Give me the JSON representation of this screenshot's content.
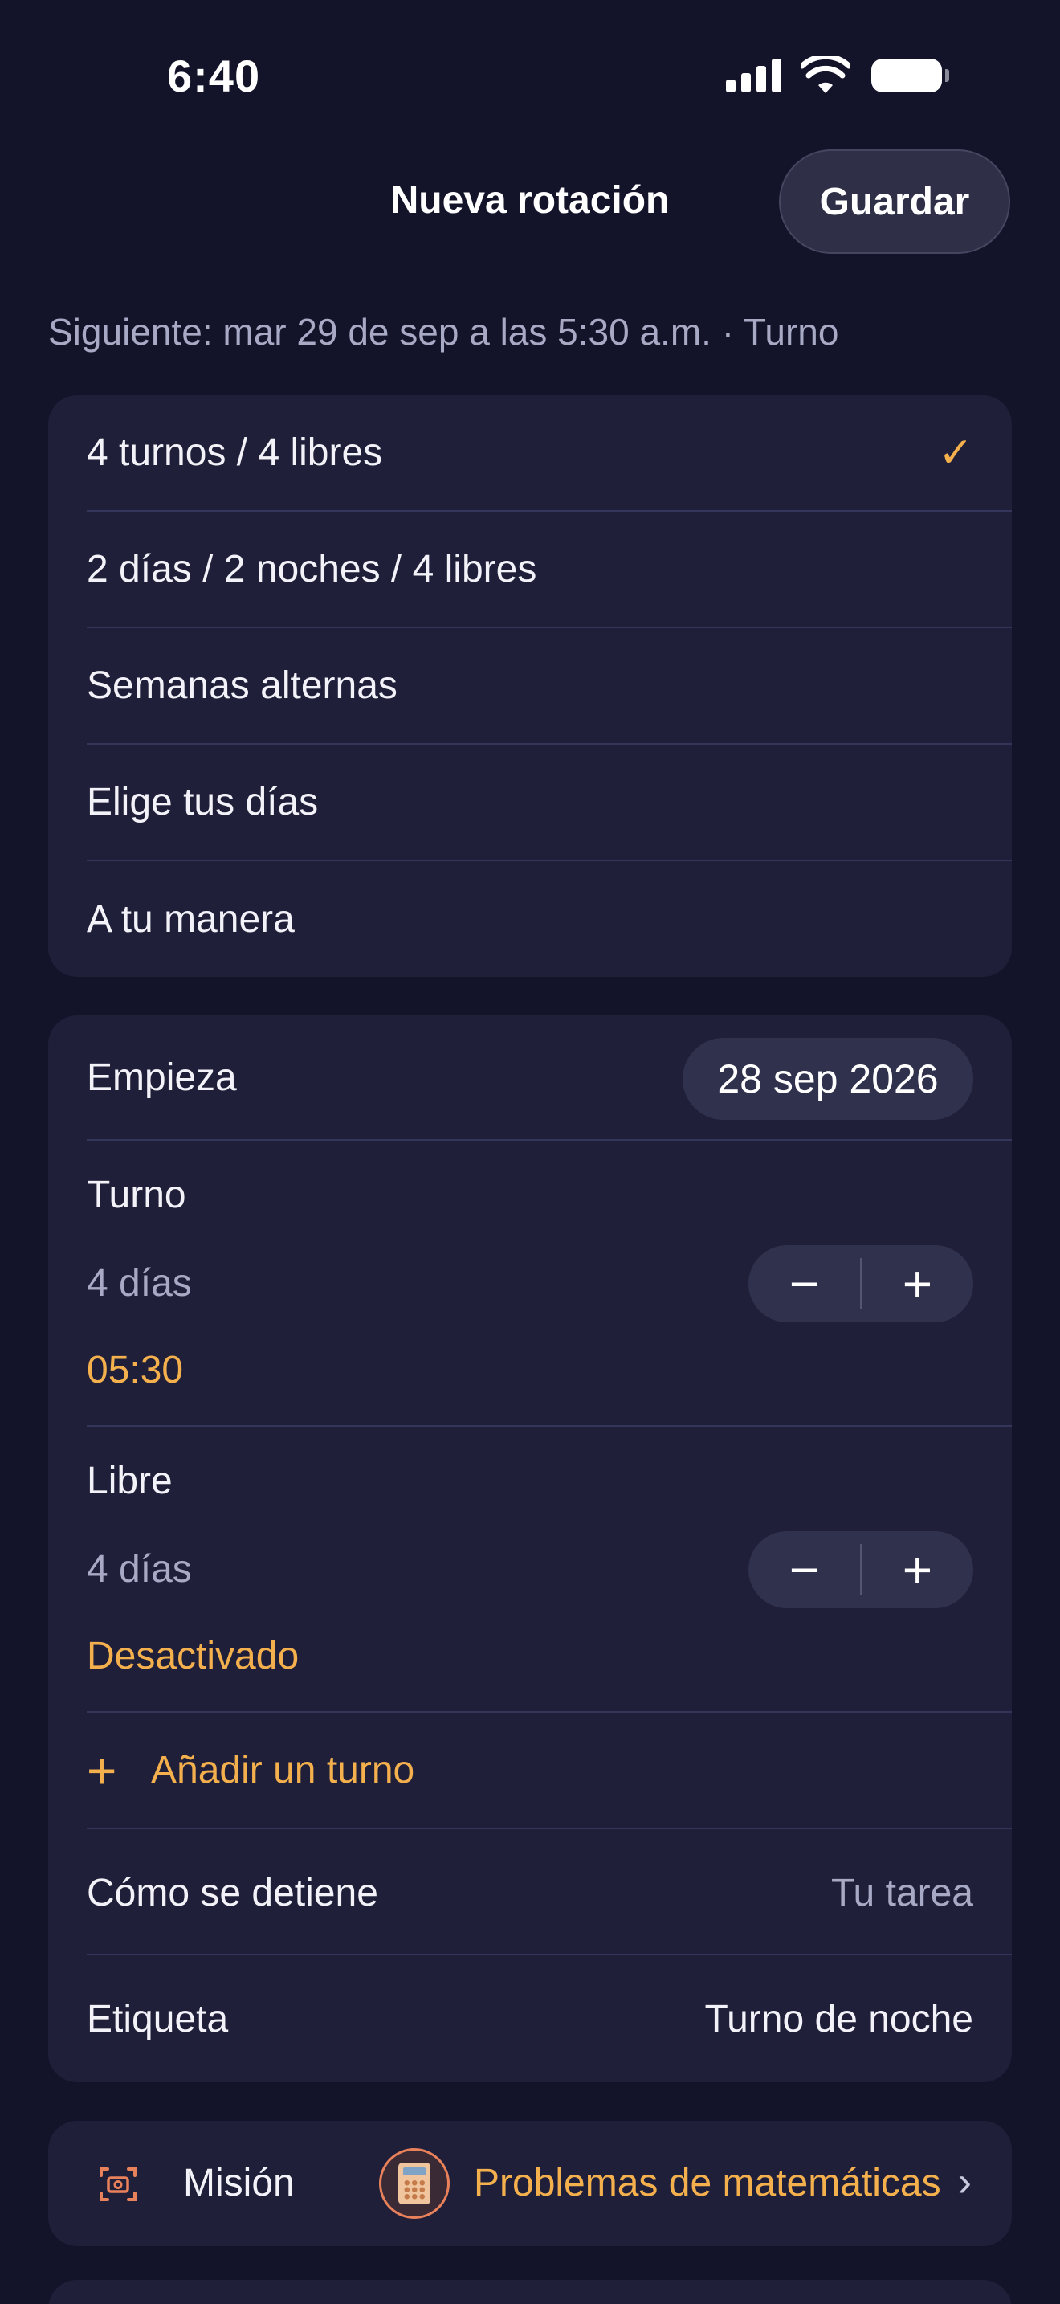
{
  "status_bar": {
    "time": "6:40"
  },
  "nav": {
    "title": "Nueva rotación",
    "save_label": "Guardar"
  },
  "next_alarm": "Siguiente: mar 29 de sep a las 5:30 a.m. · Turno",
  "patterns": [
    {
      "label": "4 turnos / 4 libres",
      "selected": true
    },
    {
      "label": "2 días / 2 noches / 4 libres",
      "selected": false
    },
    {
      "label": "Semanas alternas",
      "selected": false
    },
    {
      "label": "Elige tus días",
      "selected": false
    },
    {
      "label": "A tu manera",
      "selected": false
    }
  ],
  "check_glyph": "✓",
  "schedule": {
    "start_label": "Empieza",
    "start_date": "28 sep 2026",
    "shift": {
      "label": "Turno",
      "days": "4 días",
      "time": "05:30"
    },
    "off": {
      "label": "Libre",
      "days": "4 días",
      "status": "Desactivado"
    },
    "stepper": {
      "minus": "−",
      "plus": "+"
    },
    "add_shift_label": "Añadir un turno",
    "stop_label": "Cómo se detiene",
    "stop_value": "Tu tarea",
    "tag_label": "Etiqueta",
    "tag_value": "Turno de noche"
  },
  "mission": {
    "label": "Misión",
    "value": "Problemas de matemáticas",
    "icon": "calculator-icon"
  },
  "colors": {
    "accent": "#f5b04e",
    "background": "#13142a",
    "card": "#1f1f3a",
    "mission_icon": "#e9825a"
  }
}
